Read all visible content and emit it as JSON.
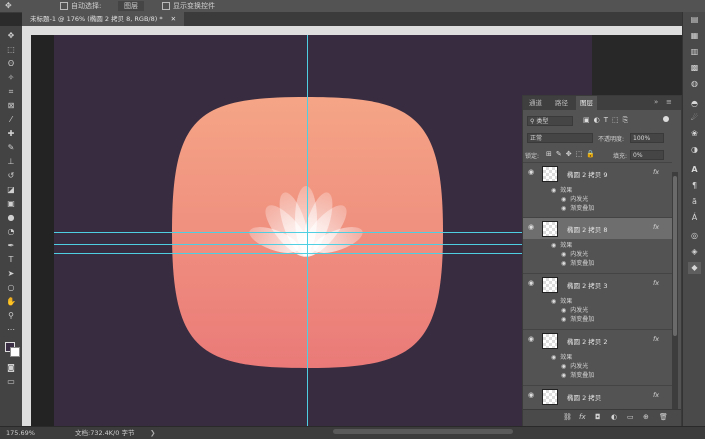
{
  "colors": {
    "background": "#372c40",
    "shape_top": "#f5a586",
    "shape_bottom": "#ea7a78",
    "guide": "#4fd0e2",
    "panel": "#535353"
  },
  "options_bar": {
    "move_icon": "move-tool-icon",
    "auto_select_label": "自动选择:",
    "auto_select_value": "图层",
    "show_transform_label": "显示变换控件"
  },
  "document": {
    "tab_title": "未标题-1 @ 176% (椭圆 2 拷贝 8, RGB/8) *",
    "close_icon": "close-icon"
  },
  "layers_panel": {
    "tabs": [
      {
        "label": "通道"
      },
      {
        "label": "路径"
      },
      {
        "label": "图层"
      }
    ],
    "filter_kind": "类型",
    "blend_mode": "正常",
    "opacity_label": "不透明度:",
    "opacity_value": "100%",
    "lock_label": "锁定:",
    "fill_label": "填充:",
    "fill_value": "0%",
    "layers": [
      {
        "name": "椭圆 2 拷贝 9",
        "fx": "fx",
        "effects_label": "效果",
        "effects": [
          "内发光",
          "渐变叠加"
        ],
        "selected": false
      },
      {
        "name": "椭圆 2 拷贝 8",
        "fx": "fx",
        "effects_label": "效果",
        "effects": [
          "内发光",
          "渐变叠加"
        ],
        "selected": true
      },
      {
        "name": "椭圆 2 拷贝 3",
        "fx": "fx",
        "effects_label": "效果",
        "effects": [
          "内发光",
          "渐变叠加"
        ],
        "selected": false
      },
      {
        "name": "椭圆 2 拷贝 2",
        "fx": "fx",
        "effects_label": "效果",
        "effects": [
          "内发光",
          "渐变叠加"
        ],
        "selected": false
      },
      {
        "name": "椭圆 2 拷贝",
        "fx": "fx",
        "effects_label": "",
        "effects": [],
        "selected": false
      }
    ],
    "footer_fx": "fx"
  },
  "status_bar": {
    "zoom": "175.69%",
    "doc_info": "文档:732.4K/0 字节"
  }
}
